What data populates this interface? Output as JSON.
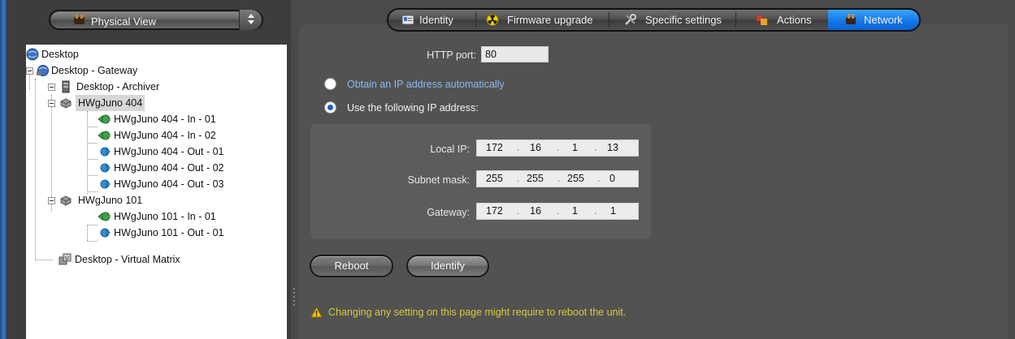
{
  "view_selector": {
    "label": "Physical View",
    "icon": "network-plug-icon"
  },
  "tree": {
    "nodes": [
      {
        "label": "Desktop",
        "icon": "globe-icon"
      },
      {
        "label": "Desktop - Gateway",
        "icon": "gateway-globe-icon"
      },
      {
        "label": "Desktop - Archiver",
        "icon": "server-icon"
      },
      {
        "label": "HWgJuno 404",
        "icon": "device-icon",
        "selected": true
      },
      {
        "label": "HWgJuno 404 - In - 01",
        "icon": "input-arrow-icon"
      },
      {
        "label": "HWgJuno 404 - In - 02",
        "icon": "input-arrow-icon"
      },
      {
        "label": "HWgJuno 404 - Out - 01",
        "icon": "output-arrow-icon"
      },
      {
        "label": "HWgJuno 404 - Out - 02",
        "icon": "output-arrow-icon"
      },
      {
        "label": "HWgJuno 404 - Out - 03",
        "icon": "output-arrow-icon"
      },
      {
        "label": "HWgJuno 101",
        "icon": "device-icon"
      },
      {
        "label": "HWgJuno 101 - In - 01",
        "icon": "input-arrow-icon"
      },
      {
        "label": "HWgJuno 101 - Out - 01",
        "icon": "output-arrow-icon"
      },
      {
        "label": "Desktop - Virtual Matrix",
        "icon": "virtual-matrix-icon"
      }
    ]
  },
  "tabs": [
    {
      "label": "Identity",
      "icon": "id-card-icon",
      "active": false
    },
    {
      "label": "Firmware upgrade",
      "icon": "radiation-icon",
      "active": false
    },
    {
      "label": "Specific settings",
      "icon": "tools-icon",
      "active": false
    },
    {
      "label": "Actions",
      "icon": "actions-icon",
      "active": false
    },
    {
      "label": "Network",
      "icon": "network-plug-icon",
      "active": true
    }
  ],
  "network": {
    "http_port_label": "HTTP port:",
    "http_port_value": "80",
    "obtain_auto_label": "Obtain an IP address automatically",
    "use_following_label": "Use the following IP address:",
    "selected_mode": "use_following",
    "local_ip_label": "Local IP:",
    "local_ip": [
      "172",
      "16",
      "1",
      "13"
    ],
    "subnet_label": "Subnet mask:",
    "subnet": [
      "255",
      "255",
      "255",
      "0"
    ],
    "gateway_label": "Gateway:",
    "gateway": [
      "172",
      "16",
      "1",
      "1"
    ],
    "ip_separator": "."
  },
  "buttons": {
    "reboot": "Reboot",
    "identify": "Identify"
  },
  "warning": {
    "text": "Changing any setting on this page might require to reboot the unit.",
    "icon": "warning-triangle-icon"
  },
  "colors": {
    "accent": "#1477e8",
    "link": "#8db8ee",
    "warning": "#d9c93c"
  }
}
